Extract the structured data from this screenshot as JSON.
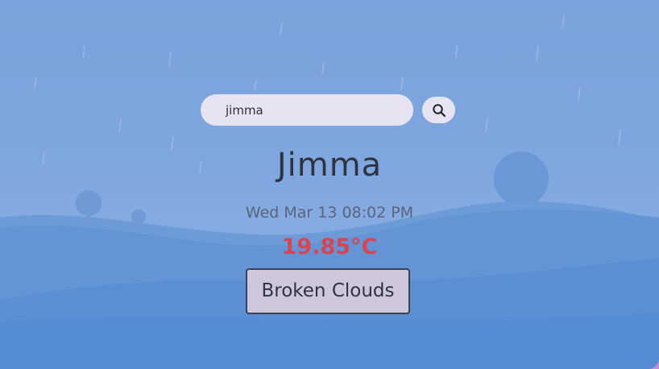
{
  "search": {
    "value": "jimma",
    "button_icon": "search-icon"
  },
  "weather": {
    "city": "Jimma",
    "datetime": "Wed Mar 13 08:02 PM",
    "temperature": "19.85°C",
    "condition": "Broken Clouds"
  },
  "colors": {
    "background": "#79a3dc",
    "temperature": "#d9454f",
    "input_bg": "#e8e3f2",
    "condition_bg": "#cfc7dc"
  }
}
